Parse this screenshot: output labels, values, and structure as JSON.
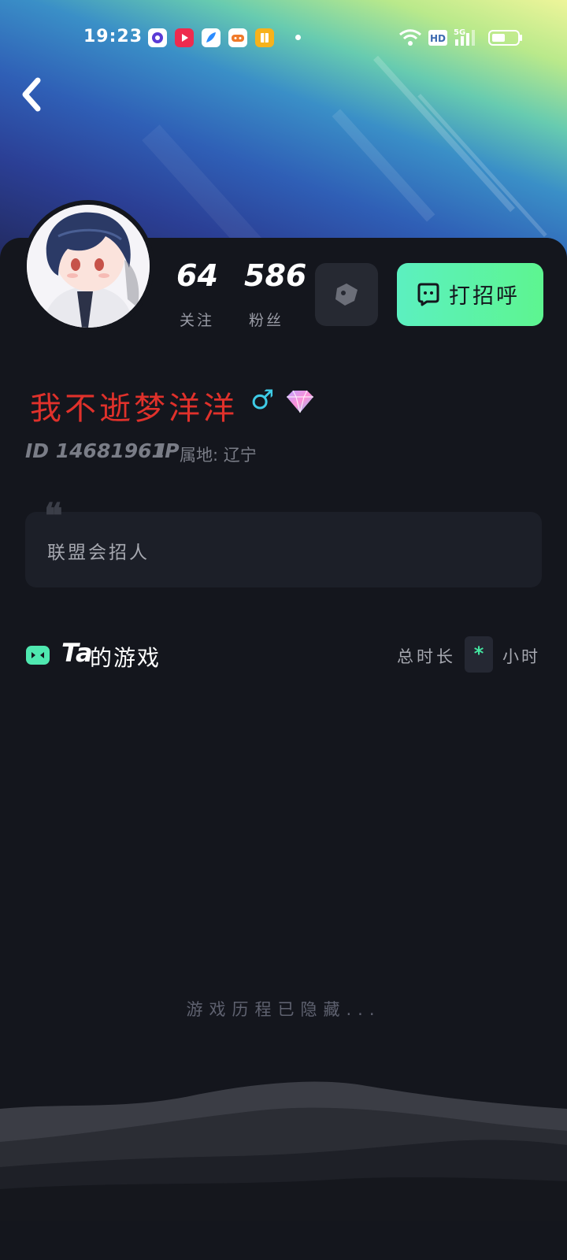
{
  "status_bar": {
    "time": "19:23",
    "app_icons": [
      "browser-icon",
      "video-icon",
      "feather-icon",
      "game-icon",
      "book-icon"
    ],
    "signal_label": "5G",
    "hd_label": "HD"
  },
  "header": {
    "back_icon": "chevron-left-icon"
  },
  "profile": {
    "following_count": "64",
    "following_label": "关注",
    "fans_count": "586",
    "fans_label": "粉丝",
    "tag_button_icon": "tag-icon",
    "greet_button_label": "打招呼",
    "greet_button_icon": "chat-icon",
    "nickname": "我不逝梦洋洋",
    "gender_symbol": "♂",
    "badge_icon": "diamond-icon",
    "id_text": "ID 14681961",
    "ip_key": "IP",
    "ip_text": "属地: 辽宁",
    "bio_quote_mark": "❝",
    "bio": "联盟会招人"
  },
  "games": {
    "title_prefix": "Ta",
    "title": "的游戏",
    "total_label": "总时长",
    "total_value": "*",
    "total_unit": "小时",
    "hidden_message": "游戏历程已隐藏..."
  },
  "colors": {
    "background": "#14161d",
    "accent_green": "#5cf0c0",
    "nickname_red": "#e0312b",
    "gender_blue": "#3ecbe6"
  }
}
